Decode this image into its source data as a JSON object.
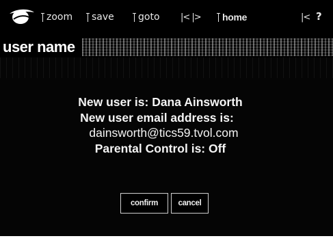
{
  "toolbar": {
    "logo_icon": "globe-swoosh-logo",
    "zoom_label": "zoom",
    "save_label": "save",
    "goto_label": "goto",
    "prev_next_label": "|< |>",
    "home_label": "home",
    "back_help_label": "|<",
    "help_label": "?"
  },
  "title": "user name",
  "message": {
    "new_user": "New user is:  Dana Ainsworth",
    "email_label": "New user email address is:",
    "email": "dainsworth@tics59.tvol.com",
    "parental_control": "Parental Control is:  Off"
  },
  "buttons": {
    "confirm_label": "confirm",
    "cancel_label": "cancel"
  },
  "colors": {
    "background": "#050505",
    "text": "#f4f4f4"
  }
}
